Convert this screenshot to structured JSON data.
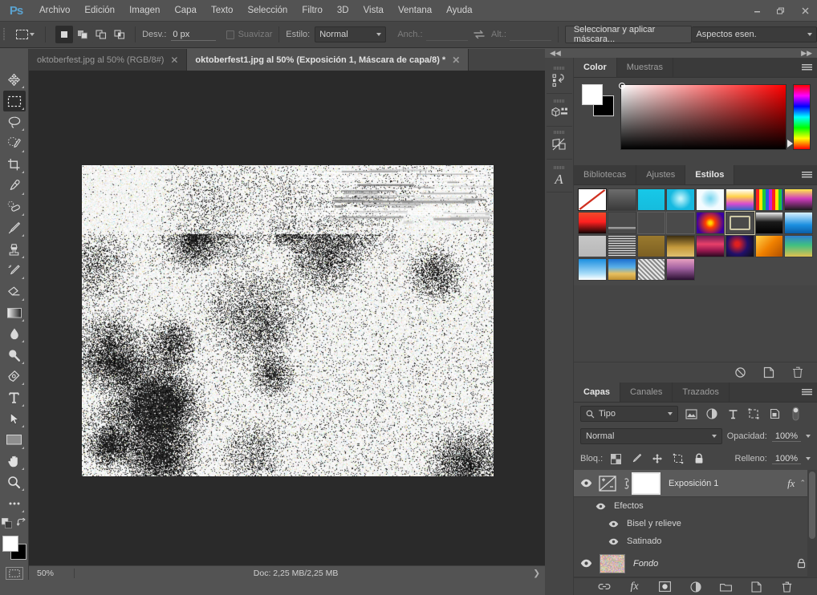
{
  "app": {
    "logo": "Ps"
  },
  "menubar": {
    "items": [
      "Archivo",
      "Edición",
      "Imagen",
      "Capa",
      "Texto",
      "Selección",
      "Filtro",
      "3D",
      "Vista",
      "Ventana",
      "Ayuda"
    ]
  },
  "window_controls": {
    "minimize": "—",
    "restore": "❐",
    "close": "✕"
  },
  "options_bar": {
    "tool": "rectangular-marquee",
    "bool_modes": [
      "new-selection",
      "add-to-selection",
      "subtract-from-selection",
      "intersect-with-selection"
    ],
    "feather_label": "Desv.:",
    "feather_value": "0 px",
    "antialias_label": "Suavizar",
    "antialias_checked": false,
    "style_label": "Estilo:",
    "style_value": "Normal",
    "width_label": "Anch.:",
    "width_value": "",
    "height_label": "Alt.:",
    "height_value": "",
    "select_mask_button": "Seleccionar y aplicar máscara...",
    "workspace_value": "Aspectos esen."
  },
  "tabs": [
    {
      "title": "oktoberfest.jpg al 50% (RGB/8#)",
      "active": false,
      "close": "✕"
    },
    {
      "title": "oktoberfest1.jpg al 50% (Exposición 1, Máscara de capa/8) *",
      "active": true,
      "close": "✕"
    }
  ],
  "toolbar": {
    "tools": [
      {
        "name": "move-tool",
        "active": false
      },
      {
        "name": "rectangular-marquee-tool",
        "active": true
      },
      {
        "name": "lasso-tool",
        "active": false
      },
      {
        "name": "quick-selection-tool",
        "active": false
      },
      {
        "name": "crop-tool",
        "active": false
      },
      {
        "name": "eyedropper-tool",
        "active": false
      },
      {
        "name": "spot-healing-brush-tool",
        "active": false
      },
      {
        "name": "brush-tool",
        "active": false
      },
      {
        "name": "clone-stamp-tool",
        "active": false
      },
      {
        "name": "history-brush-tool",
        "active": false
      },
      {
        "name": "eraser-tool",
        "active": false
      },
      {
        "name": "gradient-tool",
        "active": false
      },
      {
        "name": "blur-tool",
        "active": false
      },
      {
        "name": "dodge-tool",
        "active": false
      },
      {
        "name": "pen-tool",
        "active": false
      },
      {
        "name": "type-tool",
        "active": false
      },
      {
        "name": "path-selection-tool",
        "active": false
      },
      {
        "name": "rectangle-tool",
        "active": false
      },
      {
        "name": "hand-tool",
        "active": false
      },
      {
        "name": "zoom-tool",
        "active": false
      },
      {
        "name": "edit-toolbar-tool",
        "active": false
      }
    ],
    "foreground_color": "#ffffff",
    "background_color": "#000000",
    "quick_mask": "quick-mask-mode"
  },
  "status_bar": {
    "zoom": "50%",
    "doc_info": "Doc: 2,25 MB/2,25 MB",
    "arrow": "❯"
  },
  "dock": {
    "collapse_left": "◀◀",
    "collapse_right": "▶▶",
    "rail": [
      "history-panel-icon",
      "3d-panel-icon",
      "properties-panel-icon",
      "character-panel-icon"
    ]
  },
  "color_panel": {
    "tabs": [
      {
        "label": "Color",
        "active": true
      },
      {
        "label": "Muestras",
        "active": false
      }
    ],
    "foreground": "#ffffff",
    "background": "#000000",
    "hue_base": "#ff0000"
  },
  "styles_panel": {
    "tabs": [
      {
        "label": "Bibliotecas",
        "active": false
      },
      {
        "label": "Ajustes",
        "active": false
      },
      {
        "label": "Estilos",
        "active": true
      }
    ],
    "swatches": [
      {
        "name": "none",
        "css": "linear-gradient(135deg,#ffffff 0%,#ffffff 100%)",
        "selected": false,
        "slash": true
      },
      {
        "name": "basic-drop-shadow",
        "css": "linear-gradient(to bottom,#6d6d6d,#3a3a3a)",
        "selected": false
      },
      {
        "name": "cyan-flat",
        "css": "linear-gradient(to bottom,#17c8e8,#16bcdd)",
        "selected": false
      },
      {
        "name": "cyan-glow",
        "css": "radial-gradient(circle at 50% 45%,#bff3fb 6%,#16b9e0 60%)",
        "selected": false
      },
      {
        "name": "white-puff",
        "css": "radial-gradient(circle at 50% 45%,#7fd8f0 4%,#f2fbff 55%)",
        "selected": false
      },
      {
        "name": "rainbow-soft",
        "css": "linear-gradient(to bottom,#ffffff 0%,#ffd24a 35%,#d84bd0 70%,#2f67c8 100%)",
        "selected": false
      },
      {
        "name": "rainbow-stripes",
        "css": "repeating-linear-gradient(to right,#ff1f1f 0 4px,#ffe400 4px 8px,#19c93c 8px 12px,#1f5fe0 12px 16px,#c521d8 16px 20px)",
        "selected": false
      },
      {
        "name": "rainbow-dark",
        "css": "linear-gradient(to bottom,#ffe94a 0%,#cf3bbd 45%,#1b1b1b 100%)",
        "selected": false
      },
      {
        "name": "red-gradient",
        "css": "linear-gradient(to bottom,#f04a2a 0%,#ff2020 45%,#140404 100%)",
        "selected": false
      },
      {
        "name": "thin-line",
        "css": "linear-gradient(to bottom,#4a4a4a 0 70%,#9a9a9a 70% 78%,#4a4a4a 78% 100%)",
        "selected": false
      },
      {
        "name": "empty-frame-a",
        "css": "#4a4a4a",
        "selected": false,
        "frame": true
      },
      {
        "name": "empty-frame-b",
        "css": "#4a4a4a",
        "selected": false,
        "frame": true
      },
      {
        "name": "purple-radial",
        "css": "radial-gradient(circle at 50% 50%,#ffd400 8%,#ff3d00 28%,#3a00a0 80%)",
        "selected": false
      },
      {
        "name": "bevel-outline",
        "css": "#4a4a4a",
        "selected": true,
        "outlineframe": true
      },
      {
        "name": "black-chrome",
        "css": "linear-gradient(to bottom,#efefef 0%,#1a1a1a 45%,#000000 100%)",
        "selected": false
      },
      {
        "name": "blue-sky",
        "css": "linear-gradient(to bottom,#d7f0ff 0%,#1b8fe0 60%,#0b5fa8 100%)",
        "selected": false
      },
      {
        "name": "grey-flat",
        "css": "linear-gradient(to bottom,#c6c6c6,#b8b8b8)",
        "selected": false
      },
      {
        "name": "scribble-texture",
        "css": "repeating-linear-gradient(to bottom,#dcdcdc 0 1px,#5a5a5a 1px 3px)",
        "selected": false
      },
      {
        "name": "gold-dull",
        "css": "linear-gradient(to bottom,#9a7a2e,#7c5f22)",
        "selected": false
      },
      {
        "name": "gold-gradient",
        "css": "linear-gradient(to bottom,#3b2e12 0%,#c59a3c 55%,#e0c070 100%)",
        "selected": false
      },
      {
        "name": "pink-stripes",
        "css": "linear-gradient(to bottom,#6a1a55 0%,#e8406a 40%,#9a1850 70%,#2a0a20 100%)",
        "selected": false
      },
      {
        "name": "splatter",
        "css": "radial-gradient(circle at 40% 40%,#e02020 10%,#20106a 50%,#101020 90%)",
        "selected": false
      },
      {
        "name": "orange-gold",
        "css": "linear-gradient(135deg,#ffd24a 0%,#f08000 50%,#b05000 100%)",
        "selected": false
      },
      {
        "name": "green-blue",
        "css": "linear-gradient(to bottom,#2f7fd0 0%,#40c080 45%,#e0c050 100%)",
        "selected": false
      },
      {
        "name": "sky-fade",
        "css": "linear-gradient(to bottom,#1b8fe0 0%,#a8dcf8 70%,#ffffff 100%)",
        "selected": false
      },
      {
        "name": "beach",
        "css": "linear-gradient(to bottom,#1b6fd0 0%,#5ab0e8 40%,#e8c060 70%,#c09030 100%)",
        "selected": false
      },
      {
        "name": "noise-grey",
        "css": "repeating-linear-gradient(45deg,#e8e8e8 0 2px,#8a8a8a 2px 4px)",
        "selected": false
      },
      {
        "name": "mauve-stripe",
        "css": "linear-gradient(to bottom,#e8a0c0 0%,#a060a0 45%,#2a1030 100%)",
        "selected": false
      }
    ],
    "footer_icons": [
      "clear-style-icon",
      "new-style-icon",
      "delete-style-icon"
    ]
  },
  "layers_panel": {
    "tabs": [
      {
        "label": "Capas",
        "active": true
      },
      {
        "label": "Canales",
        "active": false
      },
      {
        "label": "Trazados",
        "active": false
      }
    ],
    "filter_label": "Tipo",
    "filter_icons": [
      "filter-pixel-icon",
      "filter-adjustment-icon",
      "filter-type-icon",
      "filter-shape-icon",
      "filter-smartobject-icon"
    ],
    "blend_mode": "Normal",
    "opacity_label": "Opacidad:",
    "opacity_value": "100%",
    "lock_label": "Bloq.:",
    "lock_icons": [
      "lock-transparency-icon",
      "lock-image-icon",
      "lock-position-icon",
      "lock-artboard-icon",
      "lock-all-icon"
    ],
    "fill_label": "Relleno:",
    "fill_value": "100%",
    "layers": [
      {
        "name": "Exposición 1",
        "type": "adjustment",
        "selected": true,
        "visible": true,
        "has_fx": true,
        "fx_label": "fx",
        "effects_group": "Efectos",
        "effects": [
          "Bisel y relieve",
          "Satinado"
        ]
      },
      {
        "name": "Fondo",
        "type": "image",
        "selected": false,
        "visible": true,
        "locked": true,
        "italic": true
      }
    ],
    "footer_icons": [
      "link-layers-icon",
      "add-style-icon",
      "add-mask-icon",
      "new-adjustment-icon",
      "new-group-icon",
      "new-layer-icon",
      "delete-layer-icon"
    ]
  },
  "canvas": {
    "document": "oktoberfest1.jpg",
    "zoom_percent": "50%",
    "background_color": "#2a2a2a",
    "image_description": "overexposed-noisy-photo"
  }
}
